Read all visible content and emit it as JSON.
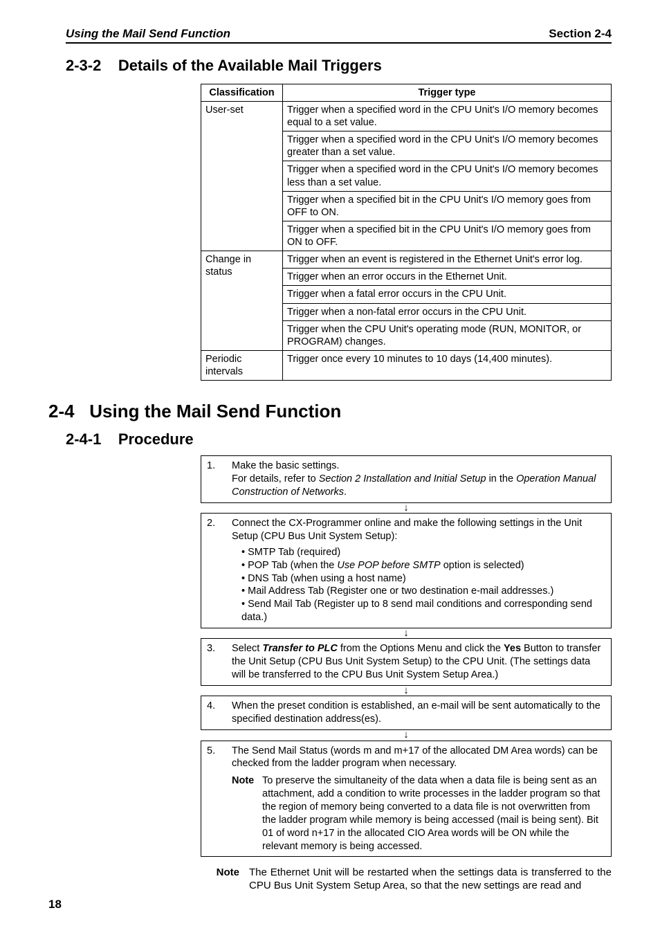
{
  "header": {
    "left": "Using the Mail Send Function",
    "right": "Section 2-4"
  },
  "sec1": {
    "num": "2-3-2",
    "title": "Details of the Available Mail Triggers"
  },
  "triggers": {
    "col1": "Classification",
    "col2": "Trigger type",
    "groups": [
      {
        "label": "User-set",
        "rows": [
          "Trigger when a specified word in the CPU Unit's I/O memory becomes equal to a set value.",
          "Trigger when a specified word in the CPU Unit's I/O memory becomes greater than a set value.",
          "Trigger when a specified word in the CPU Unit's I/O memory becomes less than a set value.",
          "Trigger when a specified bit in the CPU Unit's I/O memory goes from OFF to ON.",
          "Trigger when a specified bit in the CPU Unit's I/O memory goes from ON to OFF."
        ]
      },
      {
        "label": "Change in status",
        "rows": [
          "Trigger when an event is registered in the Ethernet Unit's error log.",
          "Trigger when an error occurs in the Ethernet Unit.",
          "Trigger when a fatal error occurs in the CPU Unit.",
          "Trigger when a non-fatal error occurs in the CPU Unit.",
          "Trigger when the CPU Unit's operating mode (RUN, MONITOR, or PROGRAM) changes."
        ]
      },
      {
        "label": "Periodic intervals",
        "rows": [
          "Trigger once every 10 minutes to 10 days (14,400 minutes)."
        ]
      }
    ]
  },
  "sec2": {
    "num": "2-4",
    "title": "Using the Mail Send Function"
  },
  "sec3": {
    "num": "2-4-1",
    "title": "Procedure"
  },
  "arrow": "↓",
  "steps": {
    "s1": {
      "num": "1.",
      "l1": "Make the basic settings.",
      "l2a": "For details, refer to ",
      "l2b": "Section 2 Installation and Initial Setup",
      "l2c": " in the ",
      "l2d": "Operation Manual Construction of Networks",
      "l2e": "."
    },
    "s2": {
      "num": "2.",
      "intro": "Connect the CX-Programmer online and make the following settings in the Unit Setup (CPU Bus Unit System Setup):",
      "b1": "SMTP Tab (required)",
      "b2a": "POP Tab (when the ",
      "b2b": "Use POP before SMTP",
      "b2c": " option is selected)",
      "b3": "DNS Tab (when using a host name)",
      "b4": "Mail Address Tab (Register one or two destination e-mail addresses.)",
      "b5": "Send Mail Tab (Register up to 8 send mail conditions and corresponding send data.)"
    },
    "s3": {
      "num": "3.",
      "a": "Select ",
      "b": "Transfer to PLC",
      "c": " from the Options Menu and click the ",
      "d": "Yes",
      "e": " Button to transfer the Unit Setup (CPU Bus Unit System Setup) to the CPU Unit. (The settings data will be transferred to the CPU Bus Unit System Setup Area.)"
    },
    "s4": {
      "num": "4.",
      "text": "When the preset condition is established, an e-mail will be sent automatically to the specified destination address(es)."
    },
    "s5": {
      "num": "5.",
      "text": "The Send Mail Status (words m and m+17 of the allocated DM Area words) can be checked from the ladder program when necessary.",
      "note_label": "Note",
      "note_text": "To preserve the simultaneity of the data when a data file is being sent as an attachment, add a condition to write processes in the ladder program so that the region of memory being converted to a data file is not overwritten from the ladder program while memory is being accessed (mail is being sent). Bit 01 of word n+17 in the allocated CIO Area words will be ON while the relevant memory is being accessed."
    }
  },
  "bottom_note": {
    "label": "Note",
    "text": "The Ethernet Unit will be restarted when the settings data is transferred to the CPU Bus Unit System Setup Area, so that the new settings are read and"
  },
  "pageno": "18"
}
